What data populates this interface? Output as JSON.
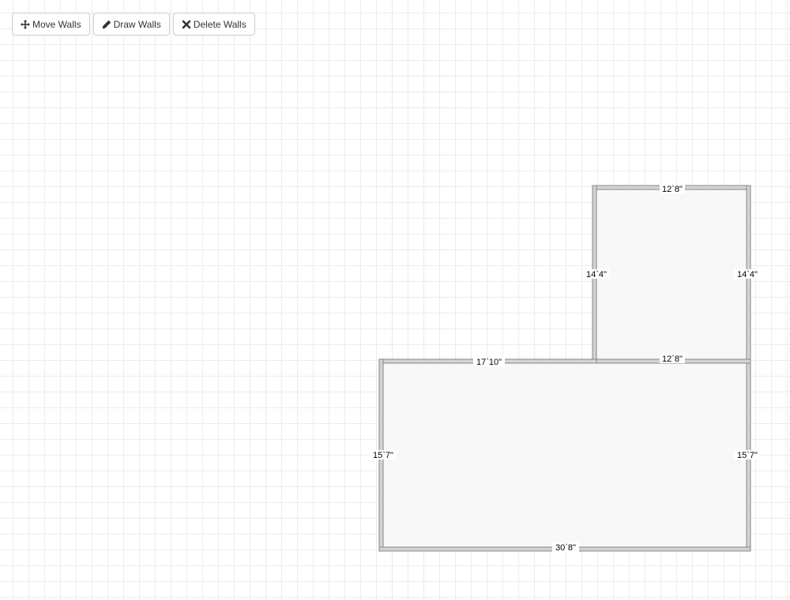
{
  "toolbar": {
    "move_walls": {
      "label": "Move Walls",
      "icon": "arrows-move-icon"
    },
    "draw_walls": {
      "label": "Draw Walls",
      "icon": "pencil-icon"
    },
    "delete_walls": {
      "label": "Delete Walls",
      "icon": "x-icon"
    }
  },
  "floorplan": {
    "room_fill": "#f8f8f8",
    "wall_color": "#d3d3d3",
    "wall_outline": "#888888",
    "dimensions": {
      "upper_top": "12`8\"",
      "upper_left": "14`4\"",
      "upper_right": "14`4\"",
      "shared_wall": "12`8\"",
      "lower_top_left": "17`10\"",
      "lower_left": "15`7\"",
      "lower_right": "15`7\"",
      "lower_bottom": "30`8\""
    }
  }
}
